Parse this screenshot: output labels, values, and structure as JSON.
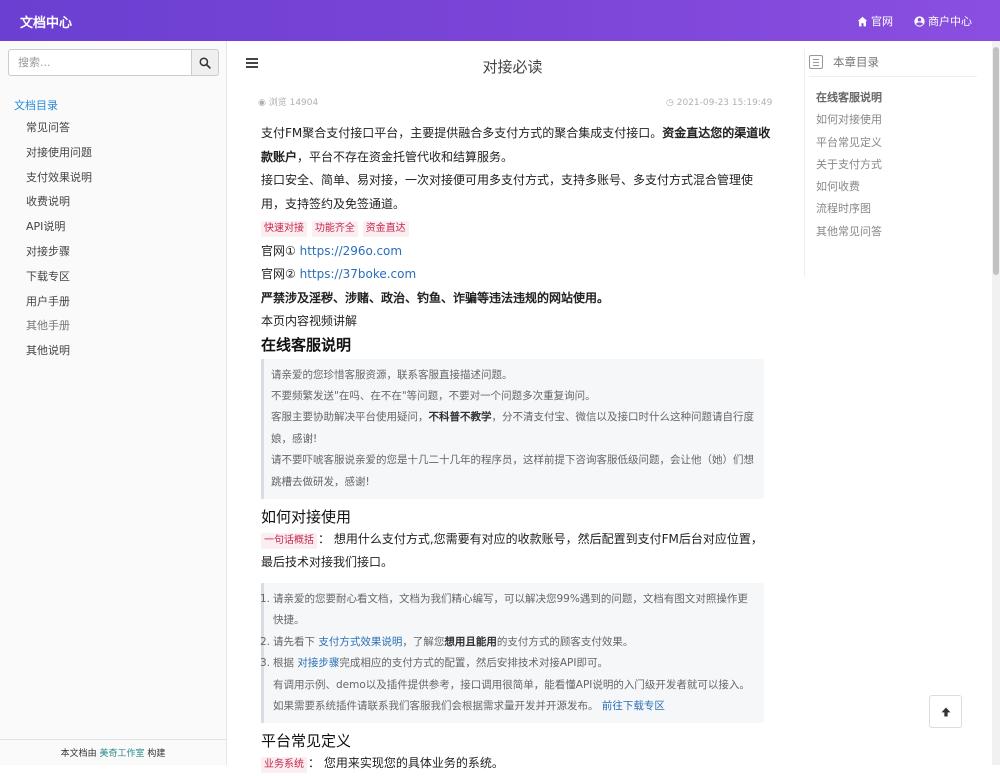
{
  "header": {
    "brand": "文档中心",
    "home_label": "官网",
    "merchant_label": "商户中心"
  },
  "sidebar": {
    "search_placeholder": "搜索...",
    "heading": "文档目录",
    "items": [
      {
        "label": "常见问答"
      },
      {
        "label": "对接使用问题"
      },
      {
        "label": "支付效果说明"
      },
      {
        "label": "收费说明"
      },
      {
        "label": "API说明"
      },
      {
        "label": "对接步骤"
      },
      {
        "label": "下载专区"
      },
      {
        "label": "用户手册"
      },
      {
        "label": "其他手册"
      },
      {
        "label": "其他说明"
      }
    ],
    "footer_prefix": "本文档由",
    "footer_studio": "美奇工作室",
    "footer_suffix": "构建"
  },
  "page": {
    "title": "对接必读",
    "views": "浏览 14904",
    "date": "2021-09-23 15:19:49"
  },
  "content": {
    "intro_1a": "支付FM聚合支付接口平台，主要提供融合多支付方式的聚合集成支付接口。",
    "intro_1b": "资金直达您的渠道收款账户",
    "intro_1c": "，平台不存在资金托管代收和结算服务。",
    "intro_2": "接口安全、简单、易对接，一次对接便可用多支付方式，支持多账号、多支付方式混合管理使用，支持签约及免签通道。",
    "tags": [
      "快速对接",
      "功能齐全",
      "资金直达"
    ],
    "site1_label": "官网①",
    "site1_url": "https://296o.com",
    "site2_label": "官网②",
    "site2_url": "https://37boke.com",
    "warning": "严禁涉及淫秽、涉赌、政治、钓鱼、诈骗等违法违规的网站使用。",
    "video_note": "本页内容视频讲解",
    "section1_title": "在线客服说明",
    "section1_q1": "请亲爱的您珍惜客服资源，联系客服直接描述问题。",
    "section1_q2": "不要频繁发送\"在吗、在不在\"等问题，不要对一个问题多次重复询问。",
    "section1_q3a": "客服主要协助解决平台使用疑问，",
    "section1_q3b": "不科普不教学",
    "section1_q3c": "，分不清支付宝、微信以及接口时什么这种问题请自行度娘，感谢!",
    "section1_q4": "请不要吓唬客服说亲爱的您是十几二十几年的程序员，这样前提下咨询客服低级问题，会让他（她）们想跳槽去做研发，感谢!",
    "section2_title": "如何对接使用",
    "section2_tag": "一句话概括",
    "section2_text": "： 想用什么支付方式,您需要有对应的收款账号，然后配置到支付FM后台对应位置，最后技术对接我们接口。",
    "section2_li1": "请亲爱的您要耐心看文档，文档为我们精心编写，可以解决您99%遇到的问题，文档有图文对照操作更快捷。",
    "section2_li2a": "请先看下",
    "section2_li2link": "支付方式效果说明",
    "section2_li2b": "，了解您",
    "section2_li2c": "想用且能用",
    "section2_li2d": "的支付方式的顾客支付效果。",
    "section2_li3a": "根据",
    "section2_li3link": "对接步骤",
    "section2_li3b": "完成相应的支付方式的配置，然后安排技术对接API即可。",
    "section2_li3c": "有调用示例、demo以及插件提供参考，接口调用很简单，能看懂API说明的入门级开发者就可以接入。如果需要系统插件请联系我们客服我们会根据需求量开发并开源发布。",
    "section2_li3link2": "前往下载专区",
    "section3_title": "平台常见定义",
    "section3_tag": "业务系统",
    "section3_text": "： 您用来实现您的具体业务的系统。"
  },
  "toc": {
    "title": "本章目录",
    "items": [
      {
        "label": "在线客服说明"
      },
      {
        "label": "如何对接使用"
      },
      {
        "label": "平台常见定义"
      },
      {
        "label": "关于支付方式"
      },
      {
        "label": "如何收费"
      },
      {
        "label": "流程时序图"
      },
      {
        "label": "其他常见问答"
      }
    ]
  },
  "colors": {
    "header_gradient_start": "#6a3fd1",
    "header_gradient_end": "#8a4fe0",
    "link": "#2a6fb8",
    "nav_active": "#2a8ad8",
    "tag_text": "#c7254e"
  }
}
